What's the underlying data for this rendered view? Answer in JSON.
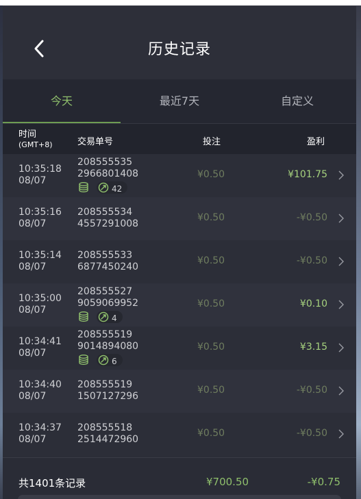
{
  "header": {
    "title": "历史记录"
  },
  "tabs": [
    {
      "label": "今天",
      "active": true
    },
    {
      "label": "最近7天",
      "active": false
    },
    {
      "label": "自定义",
      "active": false
    }
  ],
  "columns": {
    "time": "时间",
    "timezone": "(GMT+8)",
    "order": "交易单号",
    "bet": "投注",
    "profit": "盈利"
  },
  "rows": [
    {
      "time": "10:35:18",
      "date": "08/07",
      "order1": "208555535",
      "order2": "2966801408",
      "bet": "¥0.50",
      "profit": "¥101.75",
      "count": "42"
    },
    {
      "time": "10:35:16",
      "date": "08/07",
      "order1": "208555534",
      "order2": "4557291008",
      "bet": "¥0.50",
      "profit": "-¥0.50"
    },
    {
      "time": "10:35:14",
      "date": "08/07",
      "order1": "208555533",
      "order2": "6877450240",
      "bet": "¥0.50",
      "profit": "-¥0.50"
    },
    {
      "time": "10:35:00",
      "date": "08/07",
      "order1": "208555527",
      "order2": "9059069952",
      "bet": "¥0.50",
      "profit": "¥0.10",
      "count": "4"
    },
    {
      "time": "10:34:41",
      "date": "08/07",
      "order1": "208555519",
      "order2": "9014894080",
      "bet": "¥0.50",
      "profit": "¥3.15",
      "count": "6"
    },
    {
      "time": "10:34:40",
      "date": "08/07",
      "order1": "208555519",
      "order2": "1507127296",
      "bet": "¥0.50",
      "profit": "-¥0.50"
    },
    {
      "time": "10:34:37",
      "date": "08/07",
      "order1": "208555518",
      "order2": "2514472960",
      "bet": "¥0.50",
      "profit": "-¥0.50"
    }
  ],
  "footer": {
    "count": "共1401条记录",
    "bet_total": "¥700.50",
    "profit_total": "-¥0.75"
  },
  "colors": {
    "accent": "#8fbf6c",
    "positive": "#a6d27e",
    "muted": "#6f7d5f",
    "background": "#2b2d37"
  },
  "icons": {
    "back": "chevron-left-icon",
    "row": "chevron-right-icon",
    "coins": "coin-stack-icon",
    "spins": "free-spin-icon"
  }
}
